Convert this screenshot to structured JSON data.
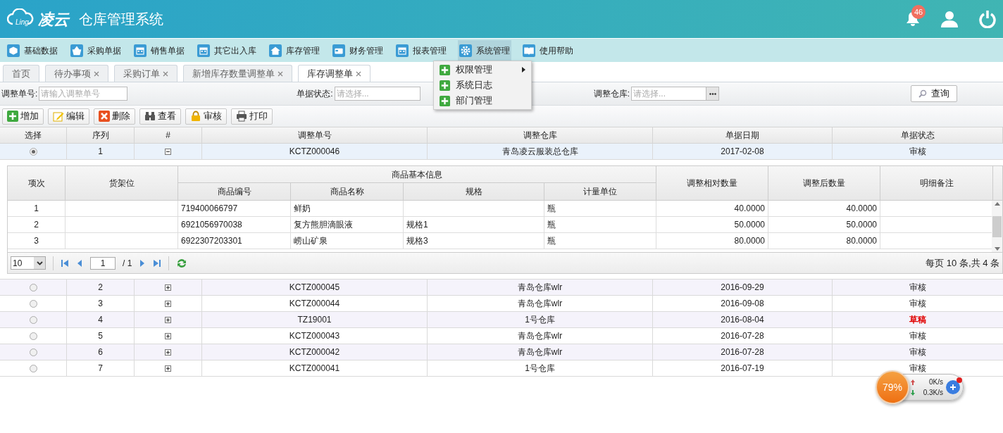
{
  "header": {
    "logo_text": "凌云",
    "logo_sub": "Ling",
    "title": "仓库管理系统",
    "notification_count": "46"
  },
  "menu": [
    {
      "label": "基础数据",
      "selected": false
    },
    {
      "label": "采购单据",
      "selected": false
    },
    {
      "label": "销售单据",
      "selected": false
    },
    {
      "label": "其它出入库",
      "selected": false
    },
    {
      "label": "库存管理",
      "selected": false
    },
    {
      "label": "财务管理",
      "selected": false
    },
    {
      "label": "报表管理",
      "selected": false
    },
    {
      "label": "系统管理",
      "selected": true
    },
    {
      "label": "使用帮助",
      "selected": false
    }
  ],
  "dropdown": [
    {
      "label": "权限管理",
      "has_submenu": true
    },
    {
      "label": "系统日志",
      "has_submenu": false
    },
    {
      "label": "部门管理",
      "has_submenu": false
    }
  ],
  "tabs": [
    {
      "label": "首页",
      "closable": false,
      "selected": false
    },
    {
      "label": "待办事项",
      "closable": true,
      "selected": false
    },
    {
      "label": "采购订单",
      "closable": true,
      "selected": false
    },
    {
      "label": "新增库存数量调整单",
      "closable": true,
      "selected": false
    },
    {
      "label": "库存调整单",
      "closable": true,
      "selected": true
    }
  ],
  "filters": [
    {
      "label": "调整单号:",
      "kind": "text",
      "placeholder": "请输入调整单号"
    },
    {
      "label": "单据状态:",
      "kind": "select",
      "placeholder": "请选择..."
    },
    {
      "label": "调整仓库:",
      "kind": "picker",
      "placeholder": "请选择..."
    }
  ],
  "query_button": "查询",
  "toolbar": [
    {
      "label": "增加"
    },
    {
      "label": "编辑"
    },
    {
      "label": "删除"
    },
    {
      "label": "查看"
    },
    {
      "label": "审核"
    },
    {
      "label": "打印"
    }
  ],
  "table": {
    "columns": [
      "选择",
      "序列",
      "#",
      "调整单号",
      "调整仓库",
      "单据日期",
      "单据状态"
    ],
    "rows": [
      {
        "index": "1",
        "number": "KCTZ000046",
        "warehouse": "青岛凌云服装总仓库",
        "date": "2017-02-08",
        "status": "审核",
        "kind": "approved",
        "selected": true,
        "expanded": true
      },
      {
        "index": "2",
        "number": "KCTZ000045",
        "warehouse": "青岛仓库wlr",
        "date": "2016-09-29",
        "status": "审核",
        "kind": "approved",
        "selected": false,
        "expanded": false
      },
      {
        "index": "3",
        "number": "KCTZ000044",
        "warehouse": "青岛仓库wlr",
        "date": "2016-09-08",
        "status": "审核",
        "kind": "approved",
        "selected": false,
        "expanded": false
      },
      {
        "index": "4",
        "number": "TZ19001",
        "warehouse": "1号仓库",
        "date": "2016-08-04",
        "status": "草稿",
        "kind": "draft",
        "selected": false,
        "expanded": false
      },
      {
        "index": "5",
        "number": "KCTZ000043",
        "warehouse": "青岛仓库wlr",
        "date": "2016-07-28",
        "status": "审核",
        "kind": "approved",
        "selected": false,
        "expanded": false
      },
      {
        "index": "6",
        "number": "KCTZ000042",
        "warehouse": "青岛仓库wlr",
        "date": "2016-07-28",
        "status": "审核",
        "kind": "approved",
        "selected": false,
        "expanded": false
      },
      {
        "index": "7",
        "number": "KCTZ000041",
        "warehouse": "1号仓库",
        "date": "2016-07-19",
        "status": "审核",
        "kind": "approved",
        "selected": false,
        "expanded": false
      }
    ]
  },
  "detail": {
    "columns": {
      "item": "项次",
      "shelf": "货架位",
      "group": "商品基本信息",
      "code": "商品编号",
      "name": "商品名称",
      "spec": "规格",
      "unit": "计量单位",
      "relative_qty": "调整相对数量",
      "after_qty": "调整后数量",
      "note": "明细备注"
    },
    "rows": [
      {
        "item": "1",
        "code": "719400066797",
        "name": "鲜奶",
        "spec": "",
        "unit": "瓶",
        "relative_qty": "40.0000",
        "after_qty": "40.0000"
      },
      {
        "item": "2",
        "code": "6921056970038",
        "name": "复方熊胆滴眼液",
        "spec": "规格1",
        "unit": "瓶",
        "relative_qty": "50.0000",
        "after_qty": "50.0000"
      },
      {
        "item": "3",
        "code": "6922307203301",
        "name": "崂山矿泉",
        "spec": "规格3",
        "unit": "瓶",
        "relative_qty": "80.0000",
        "after_qty": "80.0000"
      }
    ],
    "pager": {
      "page_size": "10",
      "page": "1",
      "total_pages": "/ 1",
      "summary": "每页 10 条,共 4 条"
    }
  },
  "widget": {
    "percent": "79%",
    "upload": "0K/s",
    "download": "0.3K/s"
  }
}
